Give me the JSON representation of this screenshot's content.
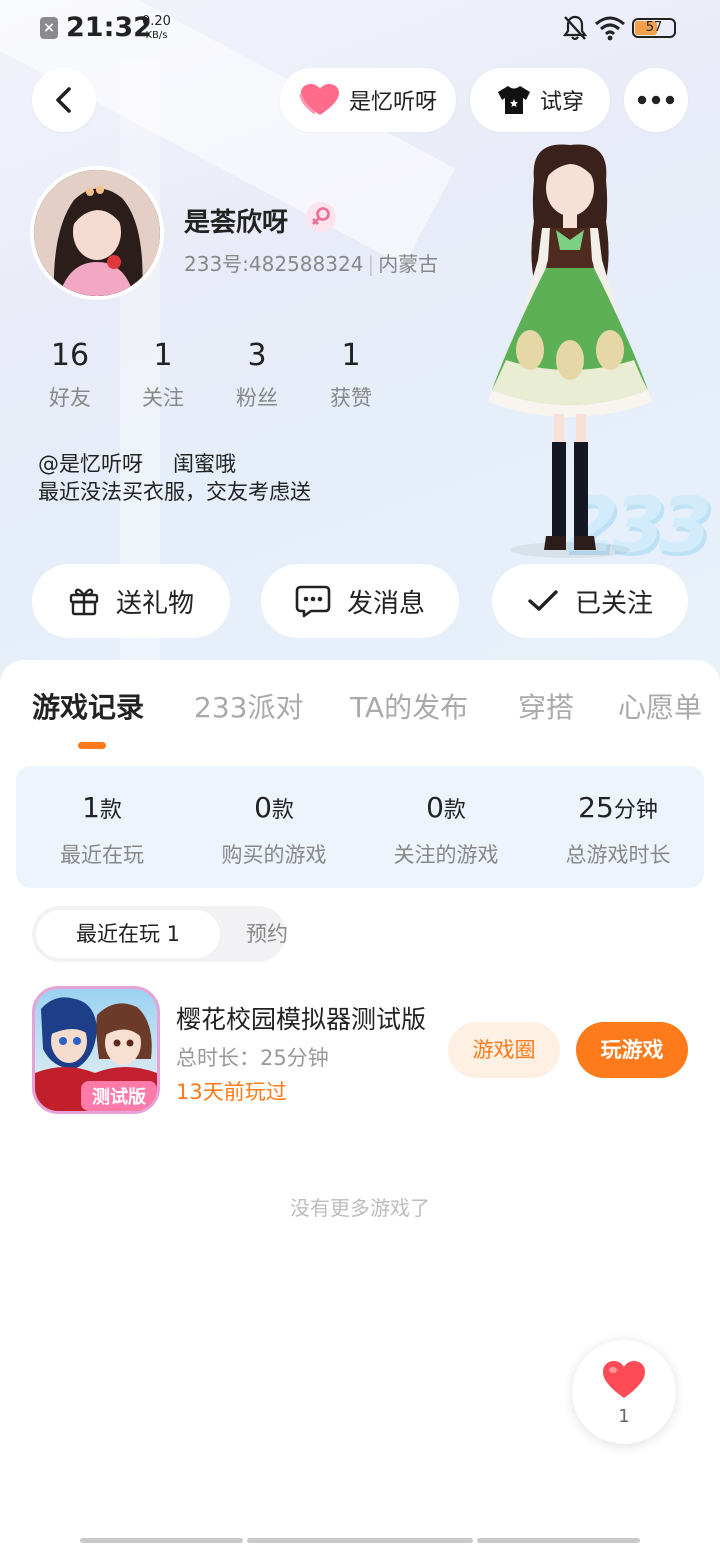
{
  "status_bar": {
    "time": "21:32",
    "speed_value": "0.20",
    "speed_unit": "KB/s",
    "battery": "57"
  },
  "header": {
    "heart_label": "是忆听呀",
    "try_label": "试穿"
  },
  "profile": {
    "name": "是荟欣呀",
    "uid": "233号:482588324",
    "region": "内蒙古",
    "stats": [
      {
        "value": "16",
        "label": "好友"
      },
      {
        "value": "1",
        "label": "关注"
      },
      {
        "value": "3",
        "label": "粉丝"
      },
      {
        "value": "1",
        "label": "获赞"
      }
    ],
    "bio_mention": "@是忆听呀",
    "bio_tag": "闺蜜哦",
    "bio_line2": "最近没法买衣服，交友考虑送",
    "watermark": "233"
  },
  "actions": {
    "gift": "送礼物",
    "message": "发消息",
    "follow": "已关注"
  },
  "tabs": [
    "游戏记录",
    "233派对",
    "TA的发布",
    "穿搭",
    "心愿单"
  ],
  "summary": [
    {
      "num": "1",
      "unit": "款",
      "label": "最近在玩"
    },
    {
      "num": "0",
      "unit": "款",
      "label": "购买的游戏"
    },
    {
      "num": "0",
      "unit": "款",
      "label": "关注的游戏"
    },
    {
      "num": "25",
      "unit": "分钟",
      "label": "总游戏时长"
    }
  ],
  "segment": {
    "recent": "最近在玩 1",
    "reserve": "预约"
  },
  "game": {
    "title": "樱花校园模拟器测试版",
    "icon_badge": "测试版",
    "duration": "总时长：25分钟",
    "last_played": "13天前玩过",
    "circle_label": "游戏圈",
    "play_label": "玩游戏"
  },
  "footer_text": "没有更多游戏了",
  "like_count": "1",
  "colors": {
    "accent": "#ff7a1a",
    "accent_light": "#fff0e4",
    "summary_bg": "#eef4fc"
  }
}
